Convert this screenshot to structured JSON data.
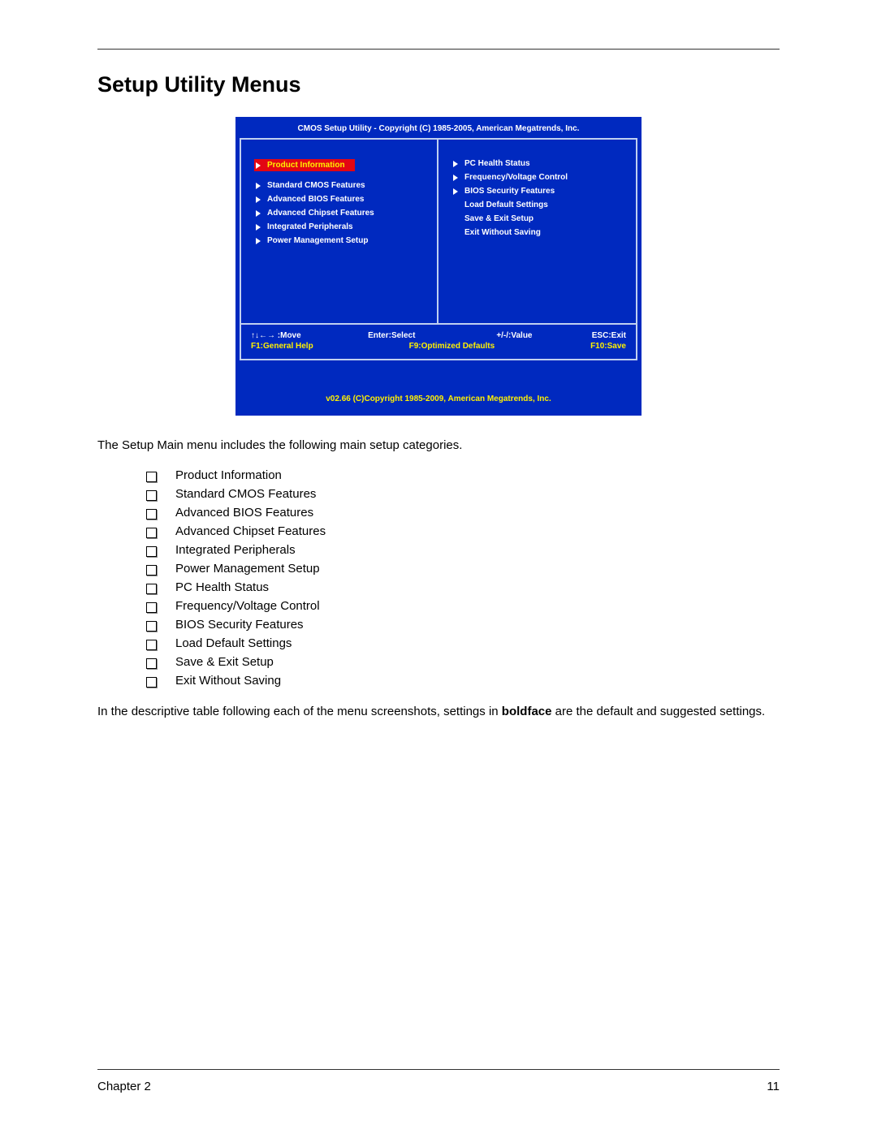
{
  "title": "Setup Utility Menus",
  "bios": {
    "header": "CMOS Setup Utility - Copyright (C) 1985-2005, American Megatrends, Inc.",
    "left": [
      {
        "label": "Product Information",
        "arrow": true,
        "hl": true
      },
      {
        "label": "Standard CMOS Features",
        "arrow": true
      },
      {
        "label": "Advanced BIOS Features",
        "arrow": true
      },
      {
        "label": "Advanced Chipset Features",
        "arrow": true
      },
      {
        "label": "Integrated Peripherals",
        "arrow": true
      },
      {
        "label": "Power Management Setup",
        "arrow": true
      }
    ],
    "right": [
      {
        "label": "PC Health Status",
        "arrow": true
      },
      {
        "label": "Frequency/Voltage Control",
        "arrow": true
      },
      {
        "label": "BIOS Security Features",
        "arrow": true
      },
      {
        "label": "Load Default Settings",
        "arrow": false
      },
      {
        "label": "Save & Exit Setup",
        "arrow": false
      },
      {
        "label": "Exit Without Saving",
        "arrow": false
      }
    ],
    "help": {
      "row1": [
        "↑↓←→ :Move",
        "Enter:Select",
        "+/-/:Value",
        "ESC:Exit"
      ],
      "row2": [
        "F1:General Help",
        "F9:Optimized Defaults",
        "F10:Save"
      ]
    },
    "footer": "v02.66 (C)Copyright 1985-2009, American Megatrends, Inc."
  },
  "intro": "The Setup Main menu includes the following main setup categories.",
  "categories": [
    "Product Information",
    "Standard CMOS Features",
    "Advanced BIOS Features",
    "Advanced Chipset Features",
    "Integrated Peripherals",
    "Power Management Setup",
    "PC Health Status",
    "Frequency/Voltage Control",
    "BIOS Security Features",
    "Load Default Settings",
    "Save & Exit Setup",
    "Exit Without Saving"
  ],
  "note_pre": "In the descriptive table following each of the menu screenshots, settings in ",
  "note_bold": "boldface",
  "note_post": " are the default and suggested settings.",
  "footer_left": "Chapter 2",
  "footer_right": "11"
}
